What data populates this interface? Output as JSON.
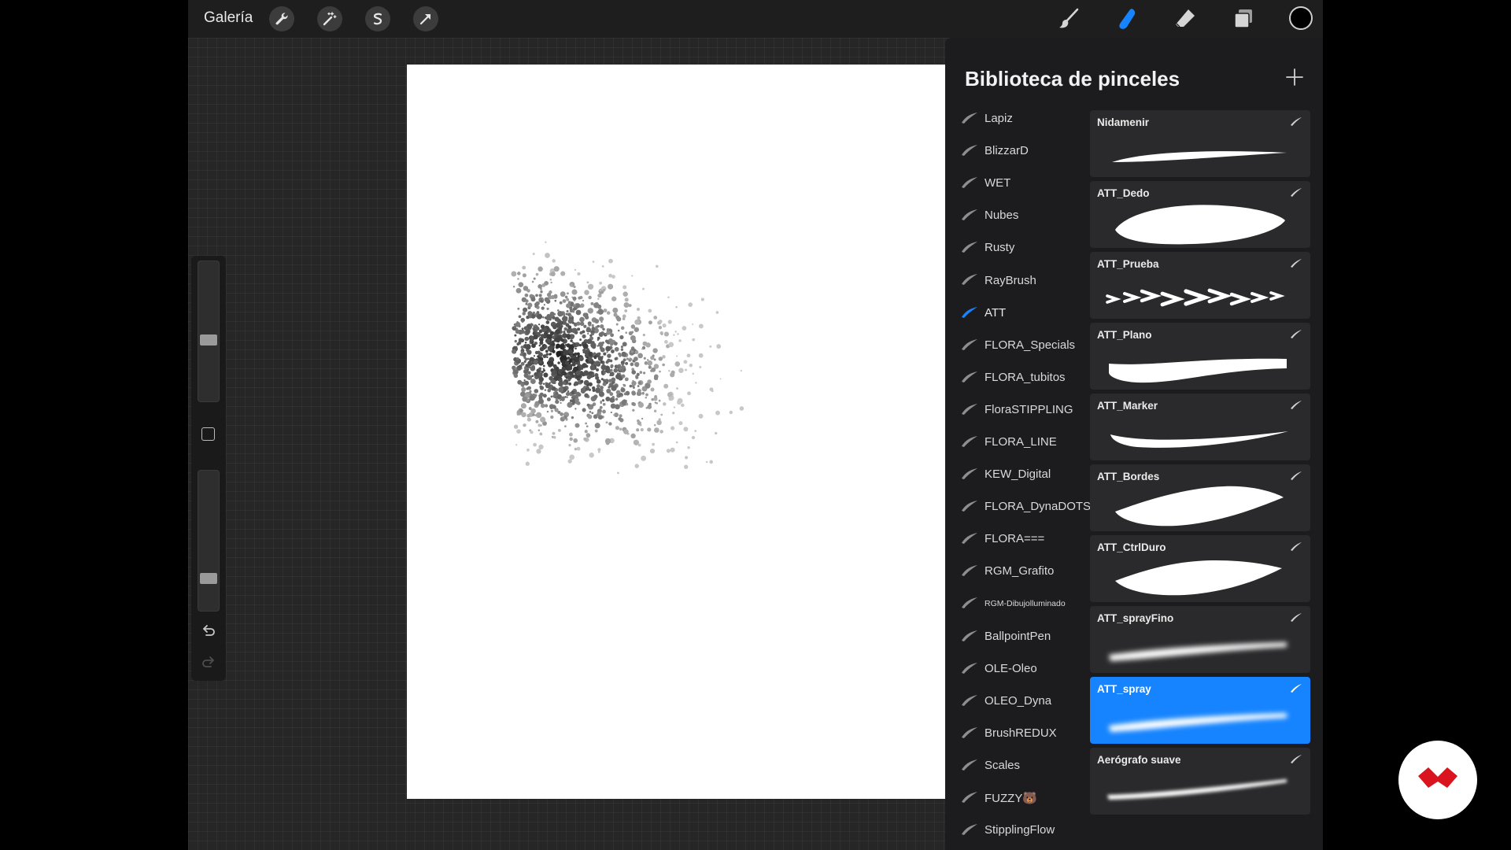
{
  "topbar": {
    "gallery_label": "Galería",
    "left_tools": [
      {
        "icon": "wrench-icon"
      },
      {
        "icon": "magic-wand-icon"
      },
      {
        "icon": "selection-icon"
      },
      {
        "icon": "transform-arrow-icon"
      }
    ],
    "right_tools": [
      {
        "icon": "brush-icon",
        "active": false
      },
      {
        "icon": "smudge-icon",
        "active": true
      },
      {
        "icon": "eraser-icon",
        "active": false
      },
      {
        "icon": "layers-icon",
        "active": false
      }
    ],
    "current_color": "#000000"
  },
  "sidebar": {
    "brush_size_level": 0.56,
    "opacity_level": 0.79,
    "icons": [
      "modify-square-icon",
      "undo-icon",
      "redo-icon"
    ]
  },
  "panel": {
    "title": "Biblioteca de pinceles",
    "add_icon": "plus-icon",
    "sets": [
      {
        "label": "Lapiz",
        "active": false
      },
      {
        "label": "BlizzarD",
        "active": false
      },
      {
        "label": "WET",
        "active": false
      },
      {
        "label": "Nubes",
        "active": false
      },
      {
        "label": "Rusty",
        "active": false
      },
      {
        "label": "RayBrush",
        "active": false
      },
      {
        "label": "ATT",
        "active": true
      },
      {
        "label": "FLORA_Specials",
        "active": false
      },
      {
        "label": "FLORA_tubitos",
        "active": false
      },
      {
        "label": "FloraSTIPPLING",
        "active": false
      },
      {
        "label": "FLORA_LINE",
        "active": false
      },
      {
        "label": "KEW_Digital",
        "active": false
      },
      {
        "label": "FLORA_DynaDOTS",
        "active": false
      },
      {
        "label": "FLORA===",
        "active": false
      },
      {
        "label": "RGM_Grafito",
        "active": false
      },
      {
        "label": "RGM-Dibujolluminado",
        "active": false,
        "small": true
      },
      {
        "label": "BallpointPen",
        "active": false
      },
      {
        "label": "OLE-Oleo",
        "active": false
      },
      {
        "label": "OLEO_Dyna",
        "active": false
      },
      {
        "label": "BrushREDUX",
        "active": false
      },
      {
        "label": "Scales",
        "active": false
      },
      {
        "label": "FUZZY🐻",
        "active": false
      },
      {
        "label": "StipplingFlow",
        "active": false
      }
    ],
    "brushes": [
      {
        "name": "Nidamenir",
        "selected": false,
        "stroke": "taper"
      },
      {
        "name": "ATT_Dedo",
        "selected": false,
        "stroke": "blob"
      },
      {
        "name": "ATT_Prueba",
        "selected": false,
        "stroke": "chevrons"
      },
      {
        "name": "ATT_Plano",
        "selected": false,
        "stroke": "flat"
      },
      {
        "name": "ATT_Marker",
        "selected": false,
        "stroke": "marker"
      },
      {
        "name": "ATT_Bordes",
        "selected": false,
        "stroke": "leaf"
      },
      {
        "name": "ATT_CtrlDuro",
        "selected": false,
        "stroke": "leaf2"
      },
      {
        "name": "ATT_sprayFino",
        "selected": false,
        "stroke": "spray"
      },
      {
        "name": "ATT_spray",
        "selected": true,
        "stroke": "spray"
      },
      {
        "name": "Aerógrafo suave",
        "selected": false,
        "stroke": "airbrush"
      }
    ]
  },
  "colors": {
    "accent": "#1684ff",
    "logo_red": "#d9141e"
  }
}
